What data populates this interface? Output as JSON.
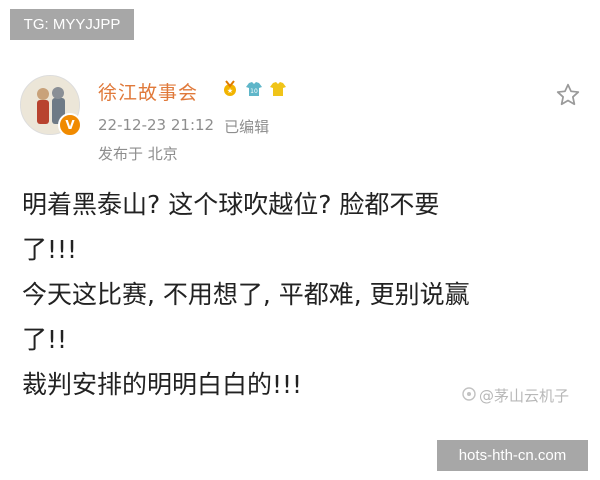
{
  "overlay": {
    "tg_label": "TG: MYYJJPP",
    "site_label": "hots-hth-cn.com"
  },
  "post": {
    "username": "徐江故事会",
    "badges": [
      "medal-icon",
      "jersey-icon",
      "shirt-icon"
    ],
    "timestamp": "22-12-23 21:12",
    "edited_label": "已编辑",
    "location": "发布于 北京",
    "body_lines": [
      "明着黑泰山? 这个球吹越位? 脸都不要",
      "了!!!",
      "今天这比赛, 不用想了, 平都难, 更别说赢",
      "了!!",
      "裁判安排的明明白白的!!!"
    ],
    "watermark": "@茅山云机子"
  },
  "colors": {
    "username": "#e0793a",
    "meta": "#8e8e8e",
    "verified": "#f08a00",
    "overlay_bg": "#a7a7a7"
  }
}
